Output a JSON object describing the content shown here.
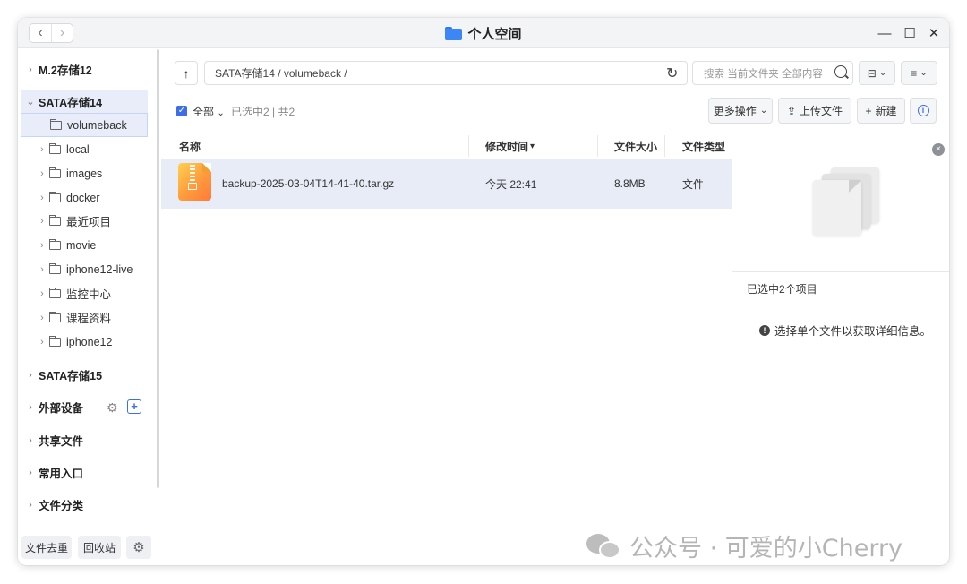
{
  "window": {
    "title": "个人空间",
    "nav_back": "‹",
    "nav_forward": "›",
    "minimize": "—",
    "maximize": "☐",
    "close": "✕"
  },
  "sidebar": {
    "sections": [
      {
        "label": "M.2存储12",
        "expanded": false
      },
      {
        "label": "SATA存储14",
        "expanded": true
      },
      {
        "label": "SATA存储15",
        "expanded": false
      },
      {
        "label": "外部设备",
        "expanded": false
      },
      {
        "label": "共享文件",
        "expanded": false
      },
      {
        "label": "常用入口",
        "expanded": false
      },
      {
        "label": "文件分类",
        "expanded": false
      }
    ],
    "folders": [
      {
        "label": "volumeback",
        "selected": true
      },
      {
        "label": "local"
      },
      {
        "label": "images"
      },
      {
        "label": "docker"
      },
      {
        "label": "最近项目"
      },
      {
        "label": "movie"
      },
      {
        "label": "iphone12-live"
      },
      {
        "label": "监控中心"
      },
      {
        "label": "课程资料"
      },
      {
        "label": "iphone12"
      }
    ],
    "external_add": "+",
    "dedup_button": "文件去重",
    "recycle_button": "回收站"
  },
  "toolbar": {
    "up": "↑",
    "path": "SATA存储14 / volumeback /",
    "refresh": "↻",
    "search_placeholder": "搜索 当前文件夹 全部内容",
    "view_toggle": "⊟",
    "sort_toggle": "≡",
    "caret": "⌄"
  },
  "selection_bar": {
    "check": "✓",
    "all_label": "全部",
    "selected_info": "已选中2 | 共2",
    "more_actions": "更多操作",
    "upload": "上传文件",
    "new": "新建",
    "info": "i"
  },
  "file_list": {
    "columns": [
      "名称",
      "修改时间",
      "文件大小",
      "文件类型"
    ],
    "sort_arrow": "▾",
    "rows": [
      {
        "name": "backup-2025-03-04T14-41-40.tar.gz",
        "modified": "今天 22:41",
        "size": "8.8MB",
        "type": "文件"
      }
    ]
  },
  "detail_panel": {
    "close": "×",
    "selected_count": "已选中2个项目",
    "message": "选择单个文件以获取详细信息。",
    "alert_glyph": "!"
  },
  "watermark": {
    "text": "公众号 · 可爱的小Cherry"
  },
  "colors": {
    "accent": "#3d6ee8",
    "selected_bg": "#e8ecf7",
    "title_bar_bg": "#f3f4f6"
  }
}
